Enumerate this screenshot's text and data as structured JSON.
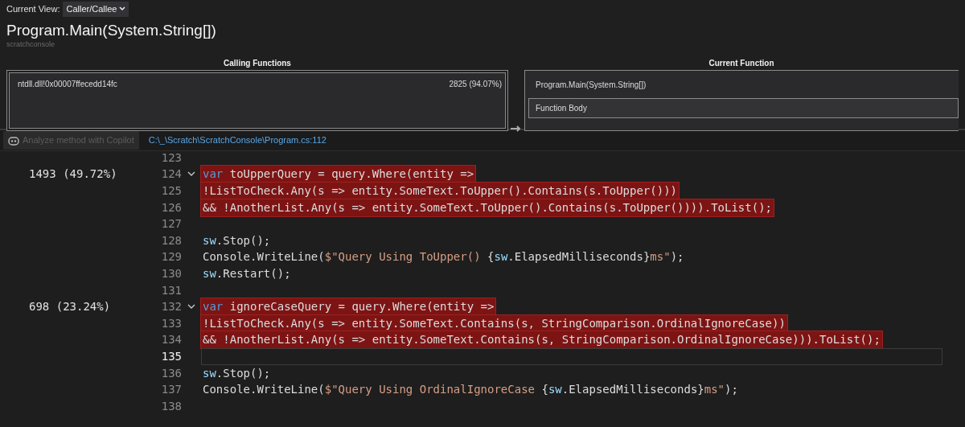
{
  "toolbar": {
    "label": "Current View:",
    "view": "Caller/Callee"
  },
  "function": {
    "title": "Program.Main(System.String[])",
    "module": "scratchconsole"
  },
  "calling_functions": {
    "heading": "Calling Functions",
    "rows": [
      {
        "name": "ntdll.dll!0x00007ffecedd14fc",
        "samples": "2825 (94.07%)"
      }
    ]
  },
  "current_function": {
    "heading": "Current Function",
    "rows": [
      {
        "name": "Program.Main(System.String[])",
        "selected": false
      },
      {
        "name": "Function Body",
        "selected": true
      }
    ]
  },
  "source_bar": {
    "copilot_button": {
      "label": "Analyze method with Copilot",
      "disabled": true
    },
    "path": "C:\\_\\Scratch\\ScratchConsole\\Program.cs:112"
  },
  "code": {
    "lines": [
      {
        "number": "123",
        "highlighted": false,
        "fold": false,
        "current": false
      },
      {
        "number": "124",
        "hits": "1493 (49.72%)",
        "highlighted": true,
        "fold": true,
        "current": false,
        "tokens": [
          {
            "kind": "keyword",
            "t": "var"
          },
          {
            "kind": "plain",
            "t": " toUpperQuery = query.Where(entity =>"
          }
        ]
      },
      {
        "number": "125",
        "highlighted": true,
        "fold": false,
        "current": false,
        "tokens": [
          {
            "kind": "plain",
            "t": "!ListToCheck.Any(s => entity.SomeText.ToUpper().Contains(s.ToUpper()))"
          }
        ]
      },
      {
        "number": "126",
        "highlighted": true,
        "fold": false,
        "current": false,
        "tokens": [
          {
            "kind": "plain",
            "t": "&& !AnotherList.Any(s => entity.SomeText.ToUpper().Contains(s.ToUpper()))).ToList();"
          }
        ]
      },
      {
        "number": "127",
        "highlighted": false,
        "fold": false,
        "current": false
      },
      {
        "number": "128",
        "highlighted": false,
        "fold": false,
        "current": false,
        "tokens": [
          {
            "kind": "variable",
            "t": "sw"
          },
          {
            "kind": "plain",
            "t": ".Stop();"
          }
        ]
      },
      {
        "number": "129",
        "highlighted": false,
        "fold": false,
        "current": false,
        "tokens": [
          {
            "kind": "plain",
            "t": "Console.WriteLine("
          },
          {
            "kind": "string",
            "t": "$\"Query Using ToUpper() "
          },
          {
            "kind": "plain",
            "t": "{"
          },
          {
            "kind": "variable",
            "t": "sw"
          },
          {
            "kind": "plain",
            "t": ".ElapsedMilliseconds}"
          },
          {
            "kind": "string",
            "t": "ms\""
          },
          {
            "kind": "plain",
            "t": ");"
          }
        ]
      },
      {
        "number": "130",
        "highlighted": false,
        "fold": false,
        "current": false,
        "tokens": [
          {
            "kind": "variable",
            "t": "sw"
          },
          {
            "kind": "plain",
            "t": ".Restart();"
          }
        ]
      },
      {
        "number": "131",
        "highlighted": false,
        "fold": false,
        "current": false
      },
      {
        "number": "132",
        "hits": "698 (23.24%)",
        "highlighted": true,
        "fold": true,
        "current": false,
        "tokens": [
          {
            "kind": "keyword",
            "t": "var"
          },
          {
            "kind": "plain",
            "t": " ignoreCaseQuery = query.Where(entity =>"
          }
        ]
      },
      {
        "number": "133",
        "highlighted": true,
        "fold": false,
        "current": false,
        "tokens": [
          {
            "kind": "plain",
            "t": "!ListToCheck.Any(s => entity.SomeText.Contains(s, StringComparison.OrdinalIgnoreCase))"
          }
        ]
      },
      {
        "number": "134",
        "highlighted": true,
        "fold": false,
        "current": false,
        "tokens": [
          {
            "kind": "plain",
            "t": "&& !AnotherList.Any(s => entity.SomeText.Contains(s, StringComparison.OrdinalIgnoreCase))).ToList();"
          }
        ]
      },
      {
        "number": "135",
        "highlighted": false,
        "fold": false,
        "current": true
      },
      {
        "number": "136",
        "highlighted": false,
        "fold": false,
        "current": false,
        "tokens": [
          {
            "kind": "variable",
            "t": "sw"
          },
          {
            "kind": "plain",
            "t": ".Stop();"
          }
        ]
      },
      {
        "number": "137",
        "highlighted": false,
        "fold": false,
        "current": false,
        "tokens": [
          {
            "kind": "plain",
            "t": "Console.WriteLine("
          },
          {
            "kind": "string",
            "t": "$\"Query Using OrdinalIgnoreCase "
          },
          {
            "kind": "plain",
            "t": "{"
          },
          {
            "kind": "variable",
            "t": "sw"
          },
          {
            "kind": "plain",
            "t": ".ElapsedMilliseconds}"
          },
          {
            "kind": "string",
            "t": "ms\""
          },
          {
            "kind": "plain",
            "t": ");"
          }
        ]
      },
      {
        "number": "138",
        "highlighted": false,
        "fold": false,
        "current": false
      }
    ]
  }
}
